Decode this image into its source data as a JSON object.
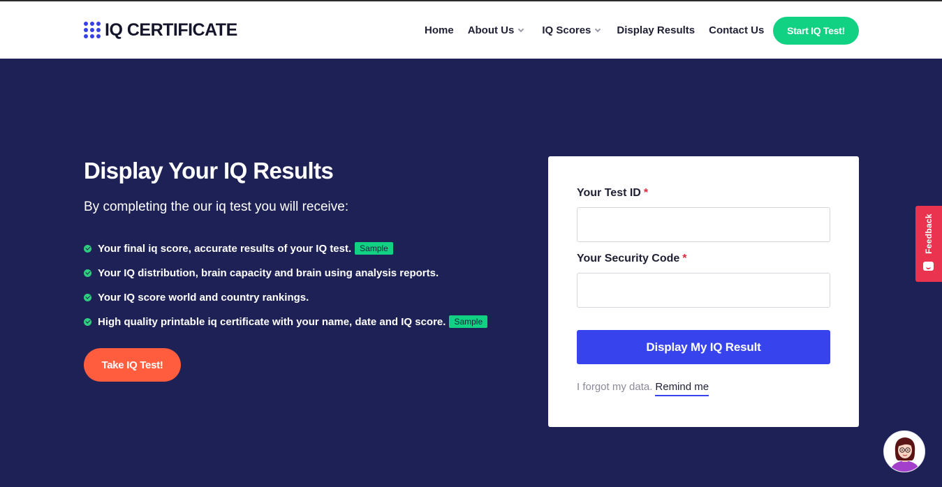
{
  "header": {
    "logo_text": "IQ CERTIFICATE",
    "nav": [
      {
        "label": "Home"
      },
      {
        "label": "About Us"
      },
      {
        "label": "IQ Scores"
      },
      {
        "label": "Display Results"
      },
      {
        "label": "Contact Us"
      }
    ],
    "cta_label": "Start IQ Test!"
  },
  "hero": {
    "title": "Display Your IQ Results",
    "subtitle": "By completing the our iq test you will receive:",
    "benefits": [
      {
        "text": "Your final iq score, accurate results of your IQ test.",
        "badge": "Sample"
      },
      {
        "text": "Your IQ distribution, brain capacity and brain using analysis reports."
      },
      {
        "text": "Your IQ score world and country rankings."
      },
      {
        "text": "High quality printable iq certificate with your name, date and IQ score.",
        "badge": "Sample"
      }
    ],
    "take_test_label": "Take IQ Test!"
  },
  "form": {
    "test_id_label": "Your Test ID",
    "test_id_value": "",
    "security_code_label": "Your Security Code",
    "security_code_value": "",
    "required_mark": "*",
    "submit_label": "Display My IQ Result",
    "forgot_text": "I forgot my data.",
    "remind_label": "Remind me"
  },
  "feedback": {
    "label": "Feedback"
  },
  "icons": {
    "logo": "dot-grid-icon",
    "nav_dropdown": "chevron-down-icon",
    "benefit_bullet": "check-circle-icon",
    "feedback": "smiley-icon",
    "chat": "avatar-icon"
  },
  "colors": {
    "hero_background": "#1e2156",
    "brand_blue": "#3743ec",
    "cta_green": "#11d183",
    "take_test_orange": "#ff5d3e",
    "feedback_red": "#e9334f",
    "required_red": "#e0263a"
  }
}
